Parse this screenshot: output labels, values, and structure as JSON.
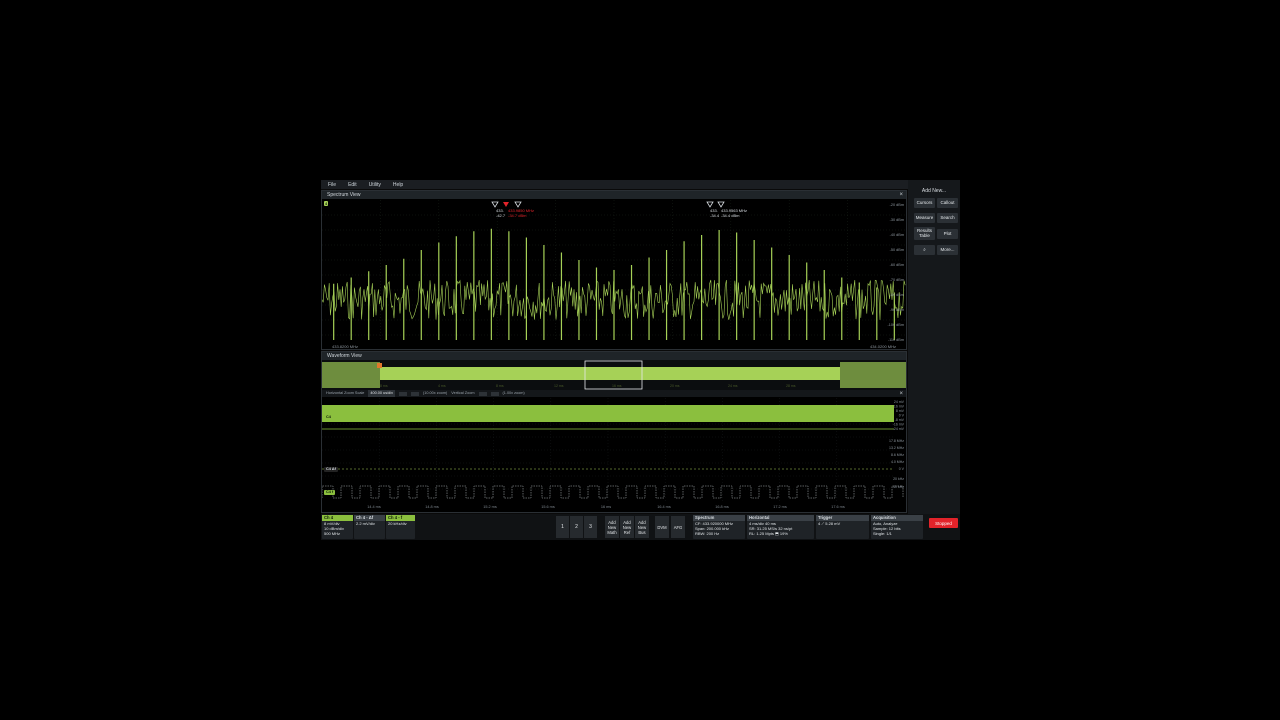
{
  "menu": [
    "File",
    "Edit",
    "Utility",
    "Help"
  ],
  "side_panel": {
    "title": "Add New...",
    "buttons": [
      "Cursors",
      "Callout",
      "Measure",
      "Search",
      "Results Table",
      "Plot",
      "More..."
    ]
  },
  "spectrum": {
    "title": "Spectrum View",
    "channel_badge": "4",
    "cursor_a_freq": "433.",
    "cursor_a_level": "-42.7",
    "cursor_a_delta_freq": "433.9850 MHz",
    "cursor_a_delta_level": "-34.7 dBm",
    "cursor_b_freq": "433.",
    "cursor_b_value": "433.9563 MHz",
    "cursor_b_level": "-34.4",
    "cursor_b_level2": "-34.4 dBm",
    "scale": [
      "-20 dBm",
      "-30 dBm",
      "-40 dBm",
      "-50 dBm",
      "-60 dBm",
      "-70 dBm",
      "-80 dBm",
      "-90 dBm",
      "-100 dBm",
      "-110 dBm"
    ],
    "start_freq": "433.8200 MHz",
    "stop_freq": "434.0200 MHz",
    "peaks": [
      {
        "x": 0.02,
        "h": 0.45
      },
      {
        "x": 0.05,
        "h": 0.5
      },
      {
        "x": 0.08,
        "h": 0.55
      },
      {
        "x": 0.11,
        "h": 0.6
      },
      {
        "x": 0.14,
        "h": 0.65
      },
      {
        "x": 0.17,
        "h": 0.72
      },
      {
        "x": 0.2,
        "h": 0.78
      },
      {
        "x": 0.23,
        "h": 0.83
      },
      {
        "x": 0.26,
        "h": 0.87
      },
      {
        "x": 0.29,
        "h": 0.89
      },
      {
        "x": 0.32,
        "h": 0.87
      },
      {
        "x": 0.35,
        "h": 0.82
      },
      {
        "x": 0.38,
        "h": 0.76
      },
      {
        "x": 0.41,
        "h": 0.7
      },
      {
        "x": 0.44,
        "h": 0.64
      },
      {
        "x": 0.47,
        "h": 0.58
      },
      {
        "x": 0.5,
        "h": 0.56
      },
      {
        "x": 0.53,
        "h": 0.6
      },
      {
        "x": 0.56,
        "h": 0.66
      },
      {
        "x": 0.59,
        "h": 0.72
      },
      {
        "x": 0.62,
        "h": 0.79
      },
      {
        "x": 0.65,
        "h": 0.84
      },
      {
        "x": 0.68,
        "h": 0.88
      },
      {
        "x": 0.71,
        "h": 0.86
      },
      {
        "x": 0.74,
        "h": 0.8
      },
      {
        "x": 0.77,
        "h": 0.74
      },
      {
        "x": 0.8,
        "h": 0.68
      },
      {
        "x": 0.83,
        "h": 0.62
      },
      {
        "x": 0.86,
        "h": 0.56
      },
      {
        "x": 0.89,
        "h": 0.5
      },
      {
        "x": 0.92,
        "h": 0.46
      },
      {
        "x": 0.95,
        "h": 0.42
      },
      {
        "x": 0.98,
        "h": 0.38
      }
    ]
  },
  "waveform": {
    "title": "Waveform View",
    "overview_ticks": [
      "8 ms",
      "4 ms",
      "8 ms",
      "12 ms",
      "16 ms",
      "20 ms",
      "24 ms",
      "28 ms"
    ],
    "zoom": {
      "horizontal_label": "Horizontal Zoom Scale",
      "horizontal_value": "400.00 us/div",
      "horizontal_zoom": "(10.00x zoom)",
      "vertical_label": "Vertical Zoom",
      "vertical_zoom": "(1.00x zoom)"
    },
    "ch4_label": "C4",
    "ch4_af_label": "C4 Δf",
    "ch4_ff_label": "C4 f",
    "scale": [
      "24 mV",
      "16 mV",
      "8 mV",
      "0 V",
      "-8 mV",
      "-16 mV",
      "-24 mV"
    ],
    "scale2": [
      "17.8 MHz",
      "13.2 MHz",
      "8.6 MHz",
      "4.0 MHz",
      "0 V"
    ],
    "scale3": [
      "20 kHz",
      "40 kHz"
    ],
    "time_ticks": [
      "14.4 ms",
      "14.8 ms",
      "15.2 ms",
      "15.6 ms",
      "16 ms",
      "16.4 ms",
      "16.8 ms",
      "17.2 ms",
      "17.6 ms"
    ]
  },
  "bottom": {
    "ch4": {
      "title": "Ch 4",
      "lines": [
        "8 mV/div",
        "10 dBm/div",
        "500 MHz"
      ]
    },
    "ch4_af": {
      "title": "Ch 4 - Δf",
      "lines": [
        "2.2 mV/div"
      ]
    },
    "ch4_ff": {
      "title": "Ch 4 - f",
      "lines": [
        "20 kHz/div"
      ]
    },
    "nav": [
      "1",
      "2",
      "3"
    ],
    "add_math": [
      "Add",
      "New",
      "Math"
    ],
    "add_ref": [
      "Add",
      "New",
      "Ref"
    ],
    "add_bus": [
      "Add",
      "New",
      "Bus"
    ],
    "dvm": "DVM",
    "afg": "AFG",
    "spectrum": {
      "title": "Spectrum",
      "lines": [
        "CF: 433.920000 MHz",
        "Span: 200.000 kHz",
        "RBW: 200 Hz"
      ]
    },
    "horizontal": {
      "title": "Horizontal",
      "lines": [
        "4 ms/div    40 ms",
        "SR: 31.25 MS/s  32 ns/pt",
        "RL: 1.25 Mpts  ⬒ 19%"
      ]
    },
    "trigger": {
      "title": "Trigger",
      "lines": [
        "4  ⟋  5.28 mV"
      ]
    },
    "acquisition": {
      "title": "Acquisition",
      "lines": [
        "Auto,      Analyze",
        "Sample: 12 bits",
        "Single: 1/1"
      ]
    },
    "stopped": "Stopped"
  },
  "colors": {
    "trace": "#a6d157",
    "accent": "#8bbf3e",
    "stopped": "#e2232a"
  }
}
